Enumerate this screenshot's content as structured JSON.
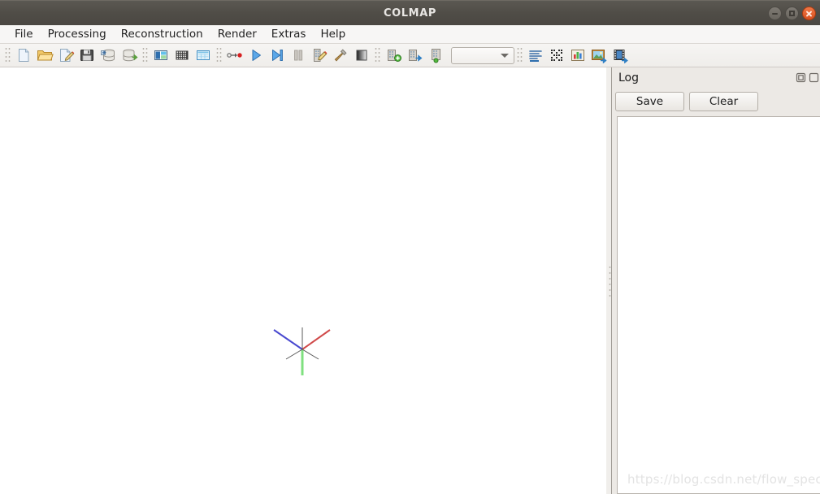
{
  "window": {
    "title": "COLMAP",
    "controls": [
      {
        "name": "minimize",
        "label": "Minimize"
      },
      {
        "name": "maximize",
        "label": "Maximize"
      },
      {
        "name": "close",
        "label": "Close"
      }
    ]
  },
  "menubar": {
    "items": [
      {
        "label": "File"
      },
      {
        "label": "Processing"
      },
      {
        "label": "Reconstruction"
      },
      {
        "label": "Render"
      },
      {
        "label": "Extras"
      },
      {
        "label": "Help"
      }
    ]
  },
  "toolbar": {
    "groups": [
      {
        "buttons": [
          {
            "icon": "new-project-icon",
            "label": "New project"
          },
          {
            "icon": "open-project-icon",
            "label": "Open project"
          },
          {
            "icon": "edit-project-icon",
            "label": "Edit project"
          },
          {
            "icon": "save-project-icon",
            "label": "Save project"
          },
          {
            "icon": "import-model-icon",
            "label": "Import model"
          },
          {
            "icon": "export-model-icon",
            "label": "Export model"
          }
        ]
      },
      {
        "buttons": [
          {
            "icon": "feature-extraction-icon",
            "label": "Feature extraction"
          },
          {
            "icon": "feature-matching-icon",
            "label": "Feature matching"
          },
          {
            "icon": "database-management-icon",
            "label": "Database management"
          }
        ]
      },
      {
        "buttons": [
          {
            "icon": "automatic-reconstruction-icon",
            "label": "Automatic reconstruction"
          },
          {
            "icon": "start-reconstruction-icon",
            "label": "Start reconstruction"
          },
          {
            "icon": "step-reconstruction-icon",
            "label": "Reconstruct next image"
          },
          {
            "icon": "pause-reconstruction-icon",
            "label": "Pause reconstruction"
          },
          {
            "icon": "bundle-adjustment-icon",
            "label": "Bundle adjustment"
          },
          {
            "icon": "dense-reconstruction-icon",
            "label": "Dense reconstruction"
          },
          {
            "icon": "render-options-icon",
            "label": "Render options"
          }
        ]
      },
      {
        "buttons": [
          {
            "icon": "model-add-icon",
            "label": "Add model"
          },
          {
            "icon": "model-next-icon",
            "label": "Next model"
          },
          {
            "icon": "model-stats-icon",
            "label": "Model statistics"
          }
        ]
      }
    ],
    "model_combo": {
      "value": "",
      "placeholder": ""
    },
    "right_buttons": [
      {
        "icon": "show-log-icon",
        "label": "Show log"
      },
      {
        "icon": "grab-image-icon",
        "label": "Grab image"
      },
      {
        "icon": "show-statistics-icon",
        "label": "Show model statistics"
      },
      {
        "icon": "grab-movie-icon",
        "label": "Grab movie"
      },
      {
        "icon": "render-video-icon",
        "label": "Render video"
      }
    ]
  },
  "viewport": {
    "name": "opengl-3d-viewport",
    "background_color": "#ffffff",
    "gizmo": {
      "x_axis_color": "#d04a4a",
      "y_axis_color": "#7fe07f",
      "z_axis_color": "#4a4ad0",
      "neutral_color": "#5a5a5a"
    }
  },
  "log_panel": {
    "title": "Log",
    "dock_actions": [
      {
        "icon": "float-dock-icon",
        "label": "Float"
      },
      {
        "icon": "close-dock-icon",
        "label": "Close"
      }
    ],
    "buttons": [
      {
        "label": "Save",
        "name": "log-save-button"
      },
      {
        "label": "Clear",
        "name": "log-clear-button"
      }
    ],
    "text": ""
  },
  "watermark": {
    "text": "https://blog.csdn.net/flow_specter"
  },
  "colors": {
    "titlebar": "#504d47",
    "toolbar": "#f2f0ed",
    "panel": "#ece9e5",
    "accent_close": "#d8501f"
  }
}
